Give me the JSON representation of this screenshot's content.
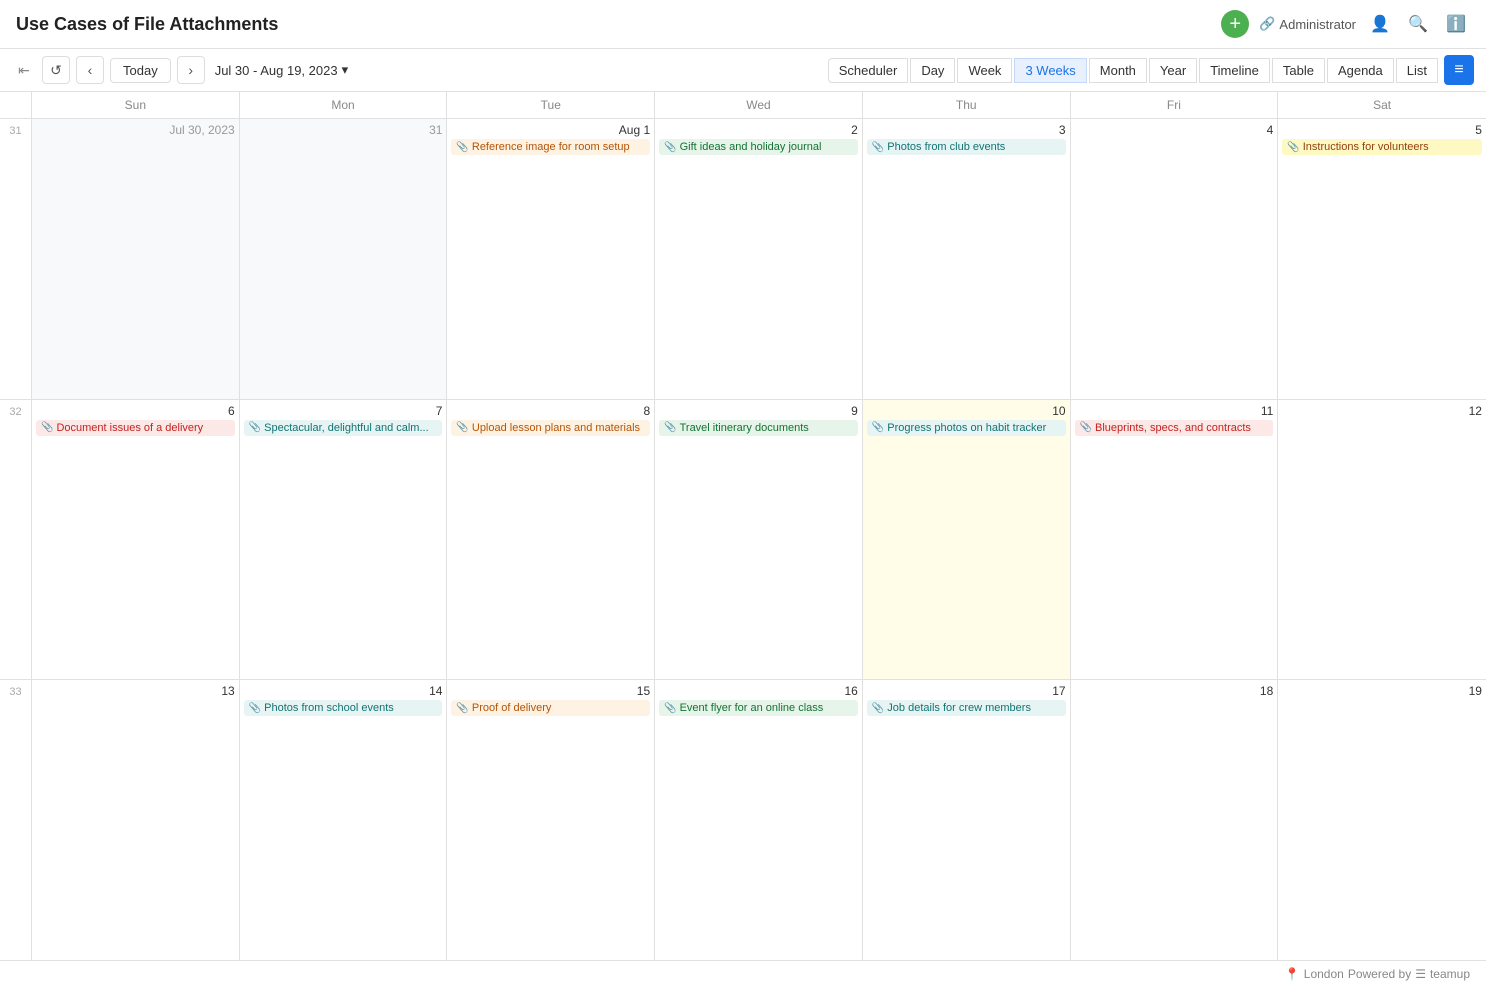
{
  "title": "Use Cases of File Attachments",
  "topbar": {
    "add_label": "+",
    "admin_label": "Administrator",
    "search_label": "🔍",
    "info_label": "ℹ"
  },
  "navbar": {
    "prev_label": "‹",
    "next_label": "›",
    "today_label": "Today",
    "date_range": "Jul 30 - Aug 19, 2023",
    "collapse_label": "⇤",
    "refresh_label": "↺",
    "views": [
      "Scheduler",
      "Day",
      "Week",
      "3 Weeks",
      "Month",
      "Year",
      "Timeline",
      "Table",
      "Agenda",
      "List"
    ]
  },
  "calendar": {
    "headers": [
      "Sun",
      "Mon",
      "Tue",
      "Wed",
      "Thu",
      "Fri",
      "Sat"
    ],
    "rows": [
      {
        "week": 31,
        "days": [
          {
            "num": 30,
            "label": "Jul 30, 2023",
            "outside": true,
            "events": []
          },
          {
            "num": 31,
            "outside": true,
            "events": []
          },
          {
            "num": 1,
            "isAug": true,
            "label": "Aug 1",
            "events": [
              {
                "text": "Reference image for room setup",
                "color": "orange"
              }
            ]
          },
          {
            "num": 2,
            "events": [
              {
                "text": "Gift ideas and holiday journal",
                "color": "green"
              }
            ]
          },
          {
            "num": 3,
            "events": [
              {
                "text": "Photos from club events",
                "color": "teal"
              }
            ]
          },
          {
            "num": 4,
            "events": []
          },
          {
            "num": 5,
            "events": [
              {
                "text": "Instructions for volunteers",
                "color": "yellow"
              }
            ]
          }
        ]
      },
      {
        "week": 32,
        "days": [
          {
            "num": 6,
            "events": [
              {
                "text": "Document issues of a delivery",
                "color": "red"
              }
            ]
          },
          {
            "num": 7,
            "events": [
              {
                "text": "Spectacular, delightful and calm...",
                "color": "teal"
              }
            ]
          },
          {
            "num": 8,
            "events": [
              {
                "text": "Upload lesson plans and materials",
                "color": "orange"
              }
            ]
          },
          {
            "num": 9,
            "events": [
              {
                "text": "Travel itinerary documents",
                "color": "green"
              }
            ]
          },
          {
            "num": 10,
            "isToday": true,
            "events": [
              {
                "text": "Progress photos on habit tracker",
                "color": "teal"
              }
            ]
          },
          {
            "num": 11,
            "events": [
              {
                "text": "Blueprints, specs, and contracts",
                "color": "red"
              }
            ]
          },
          {
            "num": 12,
            "events": []
          }
        ]
      },
      {
        "week": 33,
        "days": [
          {
            "num": 13,
            "events": []
          },
          {
            "num": 14,
            "events": [
              {
                "text": "Photos from school events",
                "color": "teal"
              }
            ]
          },
          {
            "num": 15,
            "events": [
              {
                "text": "Proof of delivery",
                "color": "orange"
              }
            ]
          },
          {
            "num": 16,
            "events": [
              {
                "text": "Event flyer for an online class",
                "color": "green"
              }
            ]
          },
          {
            "num": 17,
            "events": [
              {
                "text": "Job details for crew members",
                "color": "teal"
              }
            ]
          },
          {
            "num": 18,
            "events": []
          },
          {
            "num": 19,
            "events": []
          }
        ]
      }
    ]
  },
  "footer": {
    "location": "London",
    "powered_by": "Powered by",
    "brand": "teamup"
  }
}
